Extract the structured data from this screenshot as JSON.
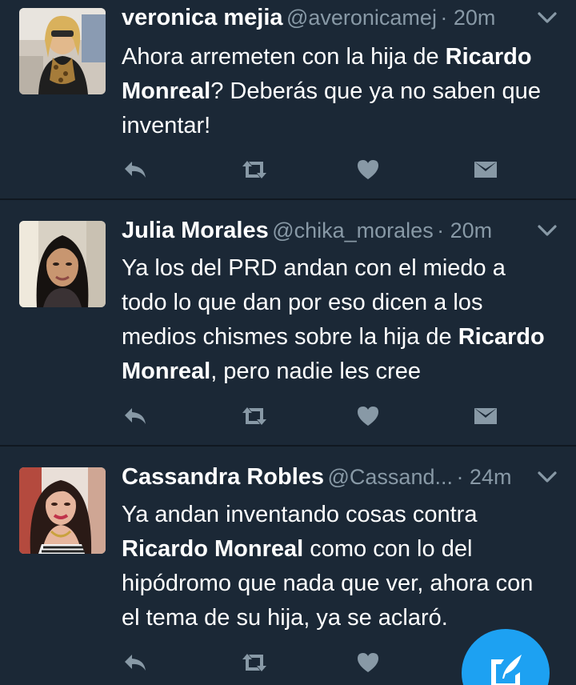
{
  "tweets": [
    {
      "name": "veronica mejia",
      "handle": "@averonicamej",
      "time": "· 20m",
      "text_before": "Ahora arremeten con la hija de ",
      "highlight": "Ricardo Monreal",
      "text_after": "? Deberás que ya no saben que inventar!"
    },
    {
      "name": "Julia Morales",
      "handle": "@chika_morales",
      "time": "· 20m",
      "text_before": "Ya los del PRD andan con el miedo a todo lo que dan por eso dicen a los medios chismes sobre la hija de ",
      "highlight": "Ricardo Monreal",
      "text_after": ", pero nadie les cree"
    },
    {
      "name": "Cassandra Robles",
      "handle": "@Cassand...",
      "time": "· 24m",
      "text_before": "Ya andan inventando cosas contra ",
      "highlight": "Ricardo Monreal",
      "text_after": " como con lo del hipódromo que nada que ver, ahora con el tema de su hija, ya se aclaró."
    }
  ],
  "icons": {
    "reply": "reply-icon",
    "retweet": "retweet-icon",
    "like": "heart-icon",
    "dm": "envelope-icon",
    "caret": "chevron-down-icon",
    "compose": "compose-icon"
  },
  "colors": {
    "background": "#1b2836",
    "divider": "#101820",
    "text": "#ffffff",
    "secondary": "#8899a6",
    "accent": "#1da1f2"
  }
}
